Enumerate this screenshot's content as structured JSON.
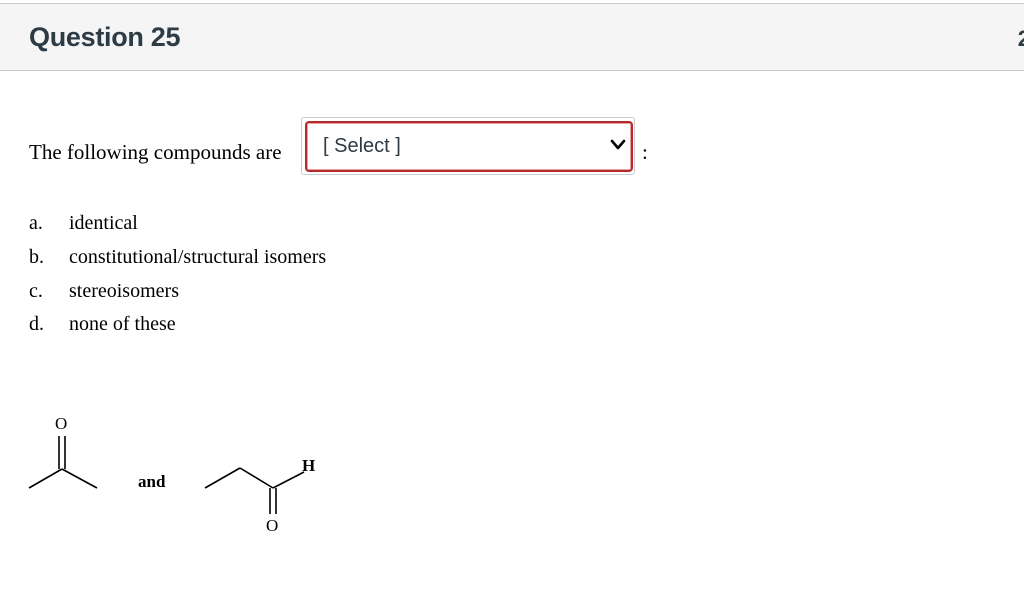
{
  "header": {
    "title": "Question 25",
    "points_fragment": "2"
  },
  "question": {
    "prompt": "The following compounds are",
    "select_value": "[ Select ]",
    "trailing": ":"
  },
  "options": [
    {
      "letter": "a.",
      "text": "identical"
    },
    {
      "letter": "b.",
      "text": "constitutional/structural isomers"
    },
    {
      "letter": "c.",
      "text": "stereoisomers"
    },
    {
      "letter": "d.",
      "text": "none of these"
    }
  ],
  "figure": {
    "left_oxygen": "O",
    "conjunction": "and",
    "right_hydrogen": "H",
    "right_oxygen": "O"
  },
  "colors": {
    "select_border": "#b52b2b",
    "header_bg": "#f5f5f5",
    "text": "#2d3b45"
  },
  "icons": {
    "select_arrow": "chevron-down-icon"
  }
}
